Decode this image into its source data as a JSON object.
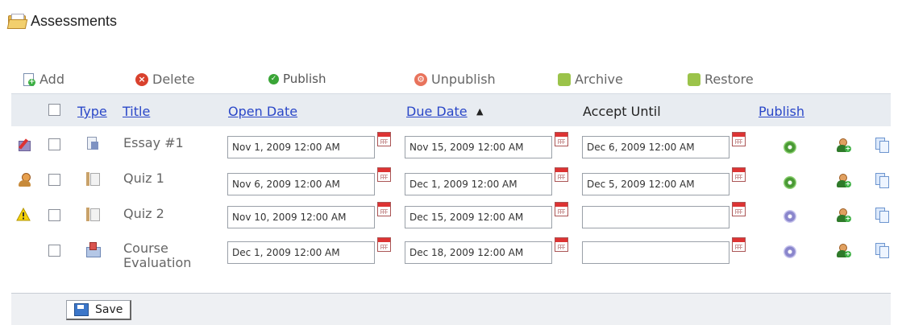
{
  "page": {
    "title": "Assessments"
  },
  "toolbar": {
    "add": "Add",
    "delete": "Delete",
    "publish": "Publish",
    "unpublish": "Unpublish",
    "archive": "Archive",
    "restore": "Restore"
  },
  "columns": {
    "type": "Type",
    "title": "Title",
    "open_date": "Open Date",
    "due_date": "Due Date",
    "sort_indicator": "▲",
    "accept_until": "Accept Until",
    "publish": "Publish"
  },
  "rows": [
    {
      "status_icon": "edit-pencil-icon",
      "type_icon": "essay-icon",
      "title": "Essay #1",
      "open_date": "Nov 1, 2009 12:00 AM",
      "due_date": "Nov 15, 2009 12:00 AM",
      "accept_until": "Dec 6, 2009 12:00 AM",
      "published": true
    },
    {
      "status_icon": "person-icon",
      "type_icon": "quiz-icon",
      "title": "Quiz 1",
      "open_date": "Nov 6, 2009 12:00 AM",
      "due_date": "Dec 1, 2009 12:00 AM",
      "accept_until": "Dec 5, 2009 12:00 AM",
      "published": true
    },
    {
      "status_icon": "warning-icon",
      "type_icon": "quiz-icon",
      "title": "Quiz 2",
      "open_date": "Nov 10, 2009 12:00 AM",
      "due_date": "Dec 15, 2009 12:00 AM",
      "accept_until": "",
      "published": false
    },
    {
      "status_icon": "",
      "type_icon": "survey-icon",
      "title_line1": "Course",
      "title_line2": "Evaluation",
      "open_date": "Dec 1, 2009 12:00 AM",
      "due_date": "Dec 18, 2009 12:00 AM",
      "accept_until": "",
      "published": false
    }
  ],
  "footer": {
    "save": "Save"
  },
  "colors": {
    "link": "#2a47c8",
    "header_bg": "#e8ecf1",
    "published": "#4a9a35",
    "unpublished": "#8a86cc"
  }
}
